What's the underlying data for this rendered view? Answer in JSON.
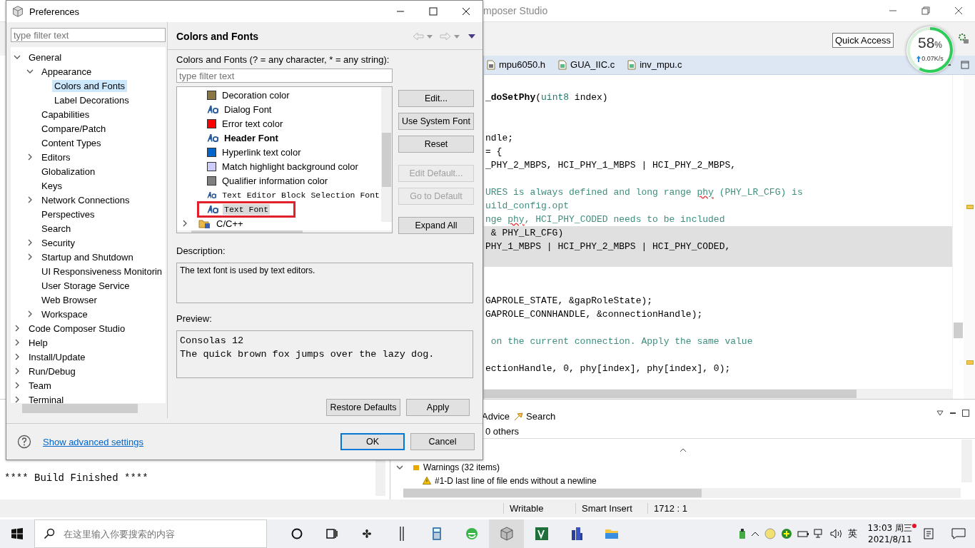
{
  "ide": {
    "title_fragment": "mposer Studio",
    "quick_access": "Quick Access",
    "net_meter": {
      "percent": "58",
      "unit": "%",
      "speed": "0.07K/s",
      "level": 0.58
    },
    "editor_tabs": [
      {
        "label": "mpu6050.h",
        "kind": "header",
        "selected": false
      },
      {
        "label": "GUA_IIC.c",
        "kind": "source",
        "selected": false
      },
      {
        "label": "inv_mpu.c",
        "kind": "source",
        "selected": false
      }
    ],
    "code_lines": [
      {
        "shaded": false,
        "segments": [
          {
            "text": "_doSetPhy",
            "kind": "bold"
          },
          {
            "text": "(",
            "kind": "plain"
          },
          {
            "text": "uint8",
            "kind": "type"
          },
          {
            "text": " index)",
            "kind": "plain"
          }
        ]
      },
      {
        "shaded": false
      },
      {
        "shaded": false
      },
      {
        "shaded": false,
        "segments": [
          {
            "text": "ndle;",
            "kind": "plain"
          }
        ]
      },
      {
        "shaded": false,
        "segments": [
          {
            "text": "= {",
            "kind": "plain"
          }
        ]
      },
      {
        "shaded": false,
        "segments": [
          {
            "text": "_PHY_2_MBPS, HCI_PHY_1_MBPS | HCI_PHY_2_MBPS,",
            "kind": "plain"
          }
        ]
      },
      {
        "shaded": false
      },
      {
        "shaded": false,
        "segments": [
          {
            "text": "URES is always defined and long range ",
            "kind": "comment"
          },
          {
            "text": "phy",
            "kind": "misspelt"
          },
          {
            "text": " (PHY_LR_CFG) is",
            "kind": "comment"
          }
        ]
      },
      {
        "shaded": false,
        "segments": [
          {
            "text": "uild_config.opt",
            "kind": "comment"
          }
        ]
      },
      {
        "shaded": false,
        "segments": [
          {
            "text": "nge ",
            "kind": "comment"
          },
          {
            "text": "phy",
            "kind": "misspelt"
          },
          {
            "text": ", HCI_PHY_CODED needs to be included",
            "kind": "comment"
          }
        ]
      },
      {
        "shaded": true,
        "segments": [
          {
            "text": " & PHY_LR_CFG)",
            "kind": "plain"
          }
        ]
      },
      {
        "shaded": true,
        "segments": [
          {
            "text": "PHY_1_MBPS | HCI_PHY_2_MBPS | HCI_PHY_CODED,",
            "kind": "plain"
          }
        ]
      },
      {
        "shaded": true
      },
      {
        "shaded": false
      },
      {
        "shaded": false
      },
      {
        "shaded": false,
        "segments": [
          {
            "text": "GAPROLE_STATE, &gapRoleState);",
            "kind": "plain"
          }
        ]
      },
      {
        "shaded": false,
        "segments": [
          {
            "text": "GAPROLE_CONNHANDLE, &connectionHandle);",
            "kind": "plain"
          }
        ]
      },
      {
        "shaded": false
      },
      {
        "shaded": false,
        "segments": [
          {
            "text": " on the current connection. Apply the same value",
            "kind": "comment"
          }
        ]
      },
      {
        "shaded": false
      },
      {
        "shaded": false,
        "segments": [
          {
            "text": "ectionHandle, 0, phy[index], phy[index], 0);",
            "kind": "plain"
          }
        ]
      }
    ],
    "console": {
      "text": "**** Build Finished ****"
    },
    "problems": {
      "tabs": [
        {
          "label": "Advice",
          "kind": "plain"
        },
        {
          "label": "Search",
          "kind": "search"
        }
      ],
      "summary": "0 others",
      "rows": [
        {
          "label": "Warnings (32 items)",
          "kind": "group",
          "expanded": true
        },
        {
          "label": "#1-D last line of file ends without a newline",
          "kind": "warning"
        }
      ]
    },
    "status_bar": [
      "Writable",
      "Smart Insert",
      "1712 : 1"
    ]
  },
  "dialog": {
    "title": "Preferences",
    "filter_placeholder": "type filter text",
    "tree": [
      {
        "label": "General",
        "expanded": true,
        "selected": false,
        "children": [
          {
            "label": "Appearance",
            "expanded": true,
            "selected": false,
            "children": [
              {
                "label": "Colors and Fonts",
                "selected": true
              },
              {
                "label": "Label Decorations",
                "selected": false
              }
            ]
          },
          {
            "label": "Capabilities",
            "selected": false
          },
          {
            "label": "Compare/Patch",
            "selected": false
          },
          {
            "label": "Content Types",
            "selected": false
          },
          {
            "label": "Editors",
            "expanded": false,
            "selected": false
          },
          {
            "label": "Globalization",
            "selected": false
          },
          {
            "label": "Keys",
            "selected": false
          },
          {
            "label": "Network Connections",
            "expanded": false,
            "selected": false
          },
          {
            "label": "Perspectives",
            "selected": false
          },
          {
            "label": "Search",
            "selected": false
          },
          {
            "label": "Security",
            "expanded": false,
            "selected": false
          },
          {
            "label": "Startup and Shutdown",
            "expanded": false,
            "selected": false
          },
          {
            "label": "UI Responsiveness Monitorin",
            "selected": false
          },
          {
            "label": "User Storage Service",
            "selected": false
          },
          {
            "label": "Web Browser",
            "selected": false
          },
          {
            "label": "Workspace",
            "expanded": false,
            "selected": false
          }
        ]
      },
      {
        "label": "Code Composer Studio",
        "expanded": false,
        "selected": false
      },
      {
        "label": "Help",
        "expanded": false,
        "selected": false
      },
      {
        "label": "Install/Update",
        "expanded": false,
        "selected": false
      },
      {
        "label": "Run/Debug",
        "expanded": false,
        "selected": false
      },
      {
        "label": "Team",
        "expanded": false,
        "selected": false
      },
      {
        "label": "Terminal",
        "expanded": false,
        "selected": false
      }
    ],
    "page_title": "Colors and Fonts",
    "list_label": "Colors and Fonts (? = any character, * = any string):",
    "list_filter_placeholder": "type filter text",
    "items": [
      {
        "label": "Decoration color",
        "kind": "color",
        "color": "#8b7543",
        "selected": false
      },
      {
        "label": "Dialog Font",
        "kind": "font",
        "selected": false
      },
      {
        "label": "Error text color",
        "kind": "color",
        "color": "#ff0000",
        "selected": false
      },
      {
        "label": "Header Font",
        "kind": "bold_font",
        "selected": false
      },
      {
        "label": "Hyperlink text color",
        "kind": "color",
        "color": "#0066cc",
        "selected": false
      },
      {
        "label": "Match highlight background color",
        "kind": "color",
        "color": "#ccccff",
        "selected": false
      },
      {
        "label": "Qualifier information color",
        "kind": "color",
        "color": "#808080",
        "selected": false
      },
      {
        "label": "Text Editor Block Selection Font",
        "kind": "mono_font",
        "selected": false
      },
      {
        "label": "Text Font",
        "kind": "mono_font",
        "selected": true,
        "outlined": true
      },
      {
        "label": "C/C++",
        "kind": "category",
        "expanded": false,
        "selected": false
      }
    ],
    "side_buttons": [
      {
        "label": "Edit...",
        "disabled": false
      },
      {
        "label": "Use System Font",
        "disabled": false
      },
      {
        "label": "Reset",
        "disabled": false
      },
      {
        "label": "Edit Default...",
        "disabled": true
      },
      {
        "label": "Go to Default",
        "disabled": true
      },
      {
        "label": "Expand All",
        "disabled": false
      }
    ],
    "description_label": "Description:",
    "description": "The text font is used by text editors.",
    "preview_label": "Preview:",
    "preview_lines": [
      "Consolas 12",
      "The quick brown fox jumps over the lazy dog."
    ],
    "page_buttons": [
      "Restore Defaults",
      "Apply"
    ],
    "help_link": "Show advanced settings",
    "buttons": [
      {
        "label": "OK",
        "default": true
      },
      {
        "label": "Cancel",
        "default": false
      }
    ]
  },
  "taskbar": {
    "search_placeholder": "在这里输入你要搜索的内容",
    "apps": [
      {
        "kind": "cortana",
        "active": false
      },
      {
        "kind": "taskview",
        "active": false
      },
      {
        "kind": "fan",
        "active": false
      },
      {
        "kind": "bars",
        "active": false
      },
      {
        "kind": "calculator",
        "active": false
      },
      {
        "kind": "browser",
        "active": false
      },
      {
        "kind": "cube",
        "active": true
      },
      {
        "kind": "v5",
        "active": false
      },
      {
        "kind": "building",
        "active": false
      },
      {
        "kind": "folder",
        "active": false
      }
    ],
    "ime": "英",
    "time": "13:03 周三",
    "date": "2021/8/11"
  }
}
